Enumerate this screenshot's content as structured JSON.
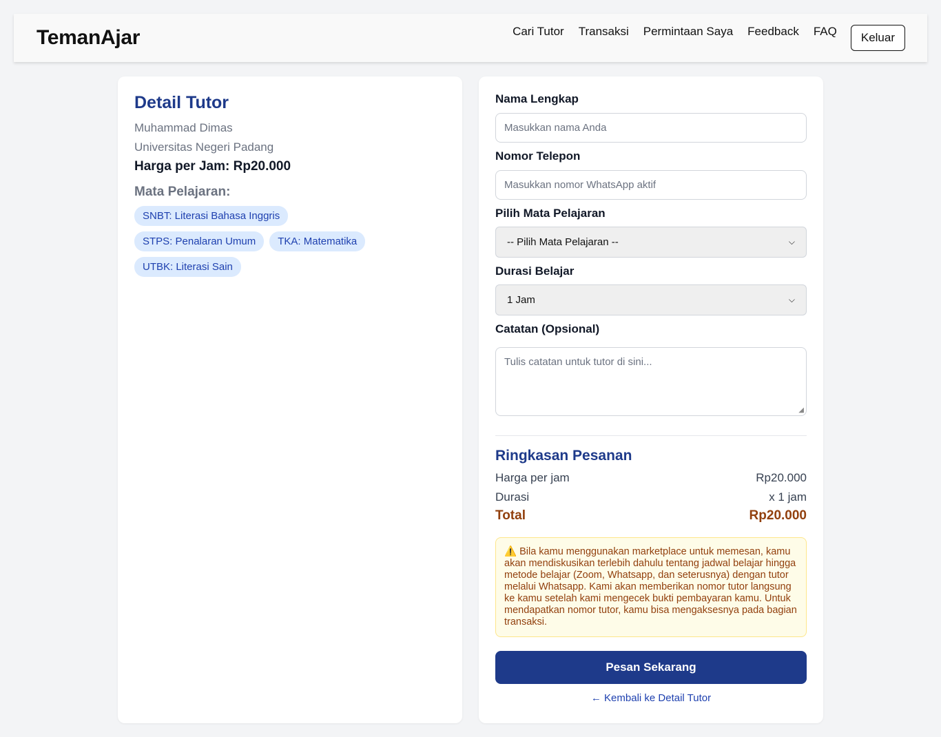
{
  "nav": {
    "brand": "TemanAjar",
    "links": [
      "Cari Tutor",
      "Transaksi",
      "Permintaan Saya",
      "Feedback",
      "FAQ"
    ],
    "logout": "Keluar"
  },
  "tutor": {
    "section_title": "Detail Tutor",
    "name": "Muhammad Dimas",
    "university": "Universitas Negeri Padang",
    "price": "Harga per Jam: Rp20.000",
    "subjects_title": "Mata Pelajaran:",
    "subjects": [
      "SNBT: Literasi Bahasa Inggris",
      "STPS: Penalaran Umum",
      "TKA: Matematika",
      "UTBK: Literasi Sain"
    ]
  },
  "form": {
    "name_label": "Nama Lengkap",
    "name_placeholder": "Masukkan nama Anda",
    "phone_label": "Nomor Telepon",
    "phone_placeholder": "Masukkan nomor WhatsApp aktif",
    "subject_label": "Pilih Mata Pelajaran",
    "subject_selected": "-- Pilih Mata Pelajaran --",
    "duration_label": "Durasi Belajar",
    "duration_selected": "1 Jam",
    "notes_label": "Catatan (Opsional)",
    "notes_placeholder": "Tulis catatan untuk tutor di sini..."
  },
  "summary": {
    "title": "Ringkasan Pesanan",
    "price_label": "Harga per jam",
    "price_value": "Rp20.000",
    "duration_label": "Durasi",
    "duration_value": "x 1 jam",
    "total_label": "Total",
    "total_value": "Rp20.000"
  },
  "warning": {
    "icon": "⚠️",
    "text": "Bila kamu menggunakan marketplace untuk memesan, kamu akan mendiskusikan terlebih dahulu tentang jadwal belajar hingga metode belajar (Zoom, Whatsapp, dan seterusnya) dengan tutor melalui Whatsapp. Kami akan memberikan nomor tutor langsung ke kamu setelah kami mengecek bukti pembayaran kamu. Untuk mendapatkan nomor tutor, kamu bisa mengaksesnya pada bagian transaksi."
  },
  "actions": {
    "submit": "Pesan Sekarang",
    "back": "← Kembali ke Detail Tutor"
  }
}
